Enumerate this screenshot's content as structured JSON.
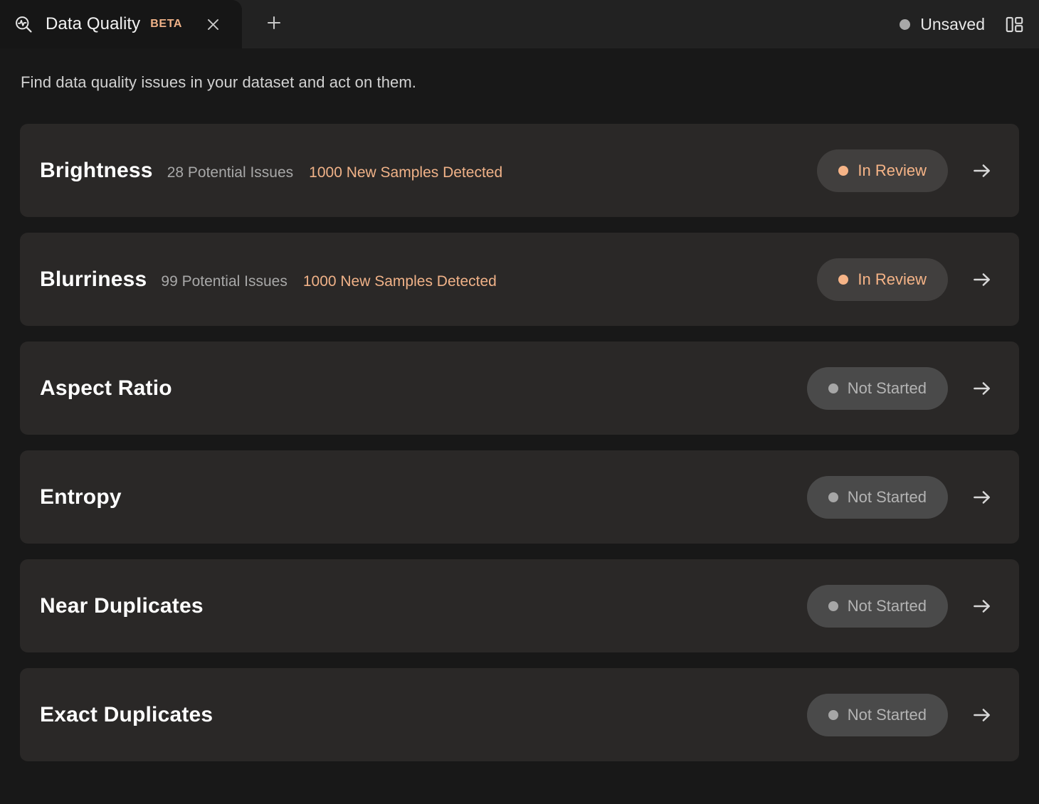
{
  "tabbar": {
    "icon": "data-quality-scan-icon",
    "title": "Data Quality",
    "beta_label": "BETA",
    "close_icon": "close-icon",
    "new_tab_icon": "plus-icon",
    "save_status": "Unsaved",
    "save_dot_color": "#a8a8a8",
    "layout_icon": "layout-panels-icon"
  },
  "page": {
    "subtitle": "Find data quality issues in your dataset and act on them."
  },
  "colors": {
    "accent_orange": "#f0b288",
    "badge_review_bg": "#413f3e",
    "badge_notstarted_bg": "#4a4a4a",
    "card_bg": "#2a2827",
    "page_bg": "#181818",
    "tabbar_bg": "#222222",
    "active_tab_bg": "#161616"
  },
  "cards": [
    {
      "title": "Brightness",
      "issues": "28 Potential Issues",
      "samples": "1000 New Samples Detected",
      "status": "In Review",
      "status_kind": "review",
      "arrow_icon": "arrow-right-icon"
    },
    {
      "title": "Blurriness",
      "issues": "99 Potential Issues",
      "samples": "1000 New Samples Detected",
      "status": "In Review",
      "status_kind": "review",
      "arrow_icon": "arrow-right-icon"
    },
    {
      "title": "Aspect Ratio",
      "issues": "",
      "samples": "",
      "status": "Not Started",
      "status_kind": "notstarted",
      "arrow_icon": "arrow-right-icon"
    },
    {
      "title": "Entropy",
      "issues": "",
      "samples": "",
      "status": "Not Started",
      "status_kind": "notstarted",
      "arrow_icon": "arrow-right-icon"
    },
    {
      "title": "Near Duplicates",
      "issues": "",
      "samples": "",
      "status": "Not Started",
      "status_kind": "notstarted",
      "arrow_icon": "arrow-right-icon"
    },
    {
      "title": "Exact Duplicates",
      "issues": "",
      "samples": "",
      "status": "Not Started",
      "status_kind": "notstarted",
      "arrow_icon": "arrow-right-icon"
    }
  ]
}
